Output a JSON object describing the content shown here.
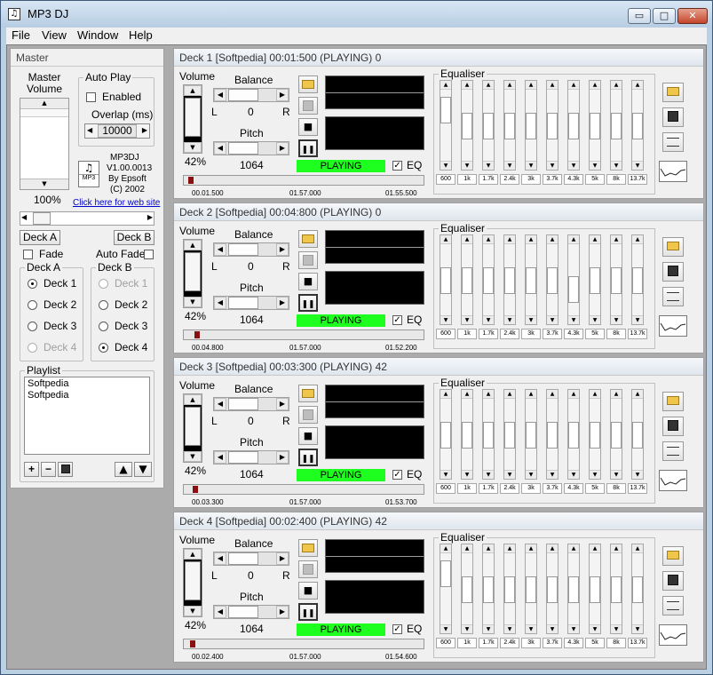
{
  "window": {
    "title": "MP3 DJ",
    "min_label": "▭",
    "max_label": "□",
    "close_label": "✕"
  },
  "menu": [
    "File",
    "View",
    "Window",
    "Help"
  ],
  "master": {
    "title": "Master",
    "master_volume_label": "Master Volume",
    "volume_percent": "100%",
    "auto_play_title": "Auto Play",
    "enabled_label": "Enabled",
    "overlap_label": "Overlap (ms)",
    "overlap_value": "10000",
    "app_info": [
      "MP3DJ",
      "V1.00.0013",
      "By  Epsoft",
      "(C) 2002"
    ],
    "app_icon_text": "MP3",
    "website_link": "Click here for web site",
    "deck_a_button": "Deck A",
    "deck_b_button": "Deck B",
    "fade_label": "Fade",
    "auto_fade_label": "Auto Fade",
    "deck_a_group": "Deck A",
    "deck_b_group": "Deck B",
    "deck_a_options": [
      {
        "label": "Deck 1",
        "selected": true,
        "disabled": false
      },
      {
        "label": "Deck 2",
        "selected": false,
        "disabled": false
      },
      {
        "label": "Deck 3",
        "selected": false,
        "disabled": false
      },
      {
        "label": "Deck 4",
        "selected": false,
        "disabled": true
      }
    ],
    "deck_b_options": [
      {
        "label": "Deck 1",
        "selected": false,
        "disabled": true
      },
      {
        "label": "Deck 2",
        "selected": false,
        "disabled": false
      },
      {
        "label": "Deck 3",
        "selected": false,
        "disabled": false
      },
      {
        "label": "Deck 4",
        "selected": true,
        "disabled": false
      }
    ],
    "playlist_title": "Playlist",
    "playlist_items": [
      "Softpedia",
      "Softpedia"
    ],
    "playlist_add": "+",
    "playlist_remove": "−",
    "playlist_up": "▲",
    "playlist_down": "▼"
  },
  "deck_labels": {
    "volume": "Volume",
    "balance": "Balance",
    "pitch": "Pitch",
    "left": "L",
    "right": "R",
    "eq": "EQ",
    "equaliser": "Equaliser",
    "stop": "■",
    "pause": "❚❚"
  },
  "eq_bands": [
    "600",
    "1k",
    "1.7k",
    "2.4k",
    "3k",
    "3.7k",
    "4.3k",
    "5k",
    "8k",
    "13.7k"
  ],
  "decks": [
    {
      "title": "Deck 1 [Softpedia] 00:01:500 (PLAYING) 0",
      "volume_percent": "42%",
      "balance_value": "0",
      "pitch_value": "1064",
      "status": "PLAYING",
      "eq_checked": true,
      "time_elapsed": "00.01.500",
      "time_mid": "01.57.000",
      "time_remaining": "01.55.500",
      "progress_fraction": 0.01,
      "eq_levels": [
        0.85,
        0.5,
        0.5,
        0.5,
        0.5,
        0.5,
        0.5,
        0.5,
        0.5,
        0.5
      ]
    },
    {
      "title": "Deck 2 [Softpedia] 00:04:800 (PLAYING) 0",
      "volume_percent": "42%",
      "balance_value": "0",
      "pitch_value": "1064",
      "status": "PLAYING",
      "eq_checked": true,
      "time_elapsed": "00.04.800",
      "time_mid": "01.57.000",
      "time_remaining": "01.52.200",
      "progress_fraction": 0.04,
      "eq_levels": [
        0.5,
        0.5,
        0.5,
        0.5,
        0.5,
        0.5,
        0.3,
        0.5,
        0.5,
        0.5
      ]
    },
    {
      "title": "Deck 3 [Softpedia] 00:03:300 (PLAYING) 42",
      "volume_percent": "42%",
      "balance_value": "0",
      "pitch_value": "1064",
      "status": "PLAYING",
      "eq_checked": true,
      "time_elapsed": "00.03.300",
      "time_mid": "01.57.000",
      "time_remaining": "01.53.700",
      "progress_fraction": 0.03,
      "eq_levels": [
        0.5,
        0.5,
        0.5,
        0.5,
        0.5,
        0.5,
        0.5,
        0.5,
        0.5,
        0.5
      ]
    },
    {
      "title": "Deck 4 [Softpedia] 00:02:400 (PLAYING) 42",
      "volume_percent": "42%",
      "balance_value": "0",
      "pitch_value": "1064",
      "status": "PLAYING",
      "eq_checked": true,
      "time_elapsed": "00.02.400",
      "time_mid": "01.57.000",
      "time_remaining": "01.54.600",
      "progress_fraction": 0.02,
      "eq_levels": [
        0.85,
        0.5,
        0.5,
        0.5,
        0.5,
        0.5,
        0.5,
        0.5,
        0.5,
        0.5
      ]
    }
  ],
  "colors": {
    "playing_bg": "#1fff1f",
    "progress_marker": "#8a1010",
    "screen_bg": "#000000"
  }
}
